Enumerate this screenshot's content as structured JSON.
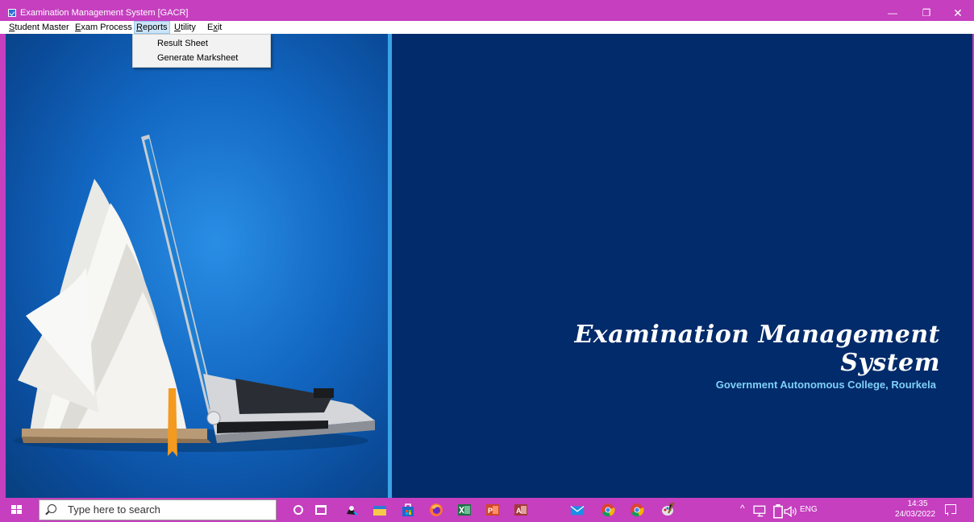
{
  "window": {
    "title": "Examination Management System  [GACR]",
    "minimize_glyph": "—",
    "maximize_glyph": "❐",
    "close_glyph": "✕"
  },
  "menubar": {
    "items": [
      {
        "label": "Student Master",
        "mnemonic": "S",
        "rest": "tudent Master"
      },
      {
        "label": "Exam Process",
        "mnemonic": "E",
        "rest": "xam Process"
      },
      {
        "label": "Reports",
        "mnemonic": "R",
        "rest": "eports",
        "active": true
      },
      {
        "label": "Utility",
        "mnemonic": "U",
        "rest": "tility"
      },
      {
        "label": "Exit",
        "pre": "E",
        "mnemonic": "x",
        "rest": "it"
      }
    ]
  },
  "dropdown": {
    "items": [
      "Result Sheet",
      "Generate Marksheet"
    ]
  },
  "main": {
    "heading": "Examination Management System",
    "subtitle": "Government Autonomous College, Rourkela"
  },
  "taskbar": {
    "search_placeholder": "Type here to search",
    "pinned": [
      "cortana-icon",
      "task-view-icon",
      "game-icon",
      "file-explorer-icon",
      "store-icon",
      "firefox-icon",
      "excel-icon",
      "powerpoint-icon",
      "access-icon",
      "mail-icon",
      "chrome-icon",
      "chrome-profile-icon",
      "paint-icon"
    ],
    "tray": {
      "chevron": "^",
      "lang": "ENG",
      "time": "14:35",
      "date": "24/03/2022"
    }
  },
  "colors": {
    "titlebar": "#c53fbf",
    "menu_active": "#cce4f7",
    "right_pane": "#022b6b",
    "subtitle": "#7fd0f7",
    "divider": "#3aa3e8"
  }
}
